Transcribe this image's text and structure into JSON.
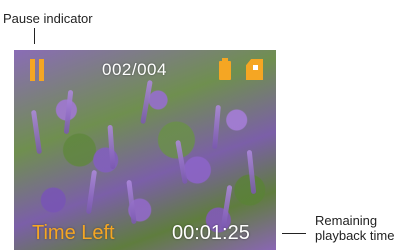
{
  "callouts": {
    "pause_indicator": "Pause indicator",
    "remaining_playback_time": "Remaining playback time"
  },
  "status_bar": {
    "counter": "002/004",
    "icons": [
      "pause-icon",
      "battery-icon",
      "memory-card-icon"
    ]
  },
  "playback": {
    "time_left_label": "Time Left",
    "time_remaining": "00:01:25"
  },
  "colors": {
    "accent": "#f5a623",
    "text": "#ffffff"
  }
}
